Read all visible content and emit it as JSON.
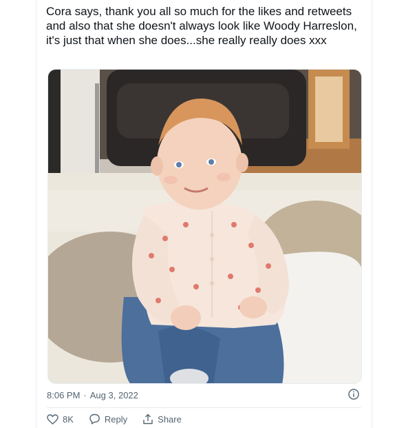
{
  "tweet": {
    "text": "Cora says, thank you all so much for the likes and retweets and also that she doesn't always look like Woody Harreslon, it's just that when she does...she really really does xxx",
    "time": "8:06 PM",
    "separator": "·",
    "date": "Aug 3, 2022"
  },
  "actions": {
    "like_count": "8K",
    "reply_label": "Reply",
    "share_label": "Share"
  },
  "icons": {
    "info": "info-icon",
    "like": "heart-icon",
    "reply": "reply-bubble-icon",
    "share": "share-icon"
  },
  "colors": {
    "text_primary": "#0f1419",
    "text_secondary": "#536471",
    "border": "#e6ecf0"
  }
}
